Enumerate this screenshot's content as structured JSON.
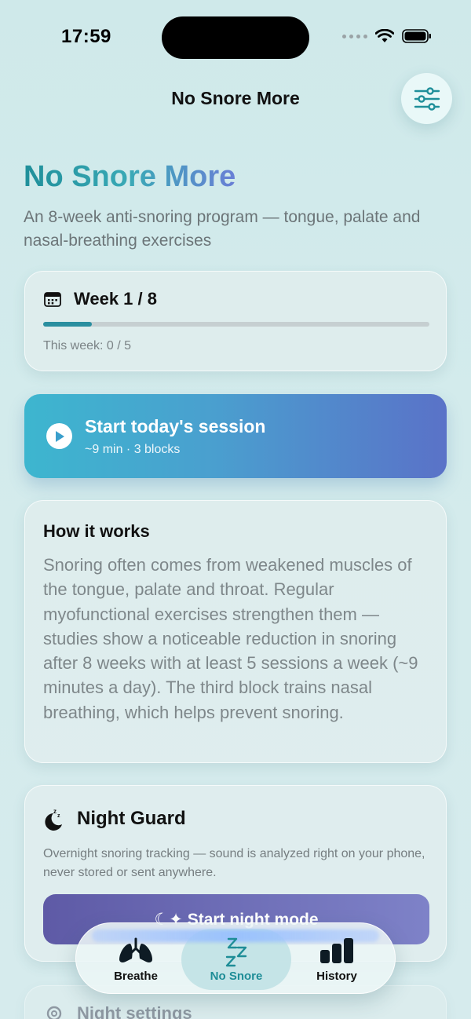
{
  "status": {
    "time": "17:59"
  },
  "nav": {
    "title": "No Snore More",
    "filter_icon": "sliders-icon"
  },
  "hero": {
    "title": "No Snore More",
    "subtitle": "An 8-week anti-snoring program — tongue, palate and nasal-breathing exercises"
  },
  "week": {
    "title": "Week 1 / 8",
    "progress": 0.125,
    "sessions_label": "This week: 0 / 5"
  },
  "session": {
    "title": "Start today's session",
    "subtitle": "~9 min · 3 blocks"
  },
  "how": {
    "title": "How it works",
    "body": "Snoring often comes from weakened muscles of the tongue, palate and throat. Regular myofunctional exercises strengthen them — studies show a noticeable reduction in snoring after 8 weeks with at least 5 sessions a week (~9 minutes a day). The third block trains nasal breathing, which helps prevent snoring."
  },
  "night_guard": {
    "title": "Night Guard",
    "description": "Overnight snoring tracking — sound is analyzed right on your phone, never stored or sent anywhere.",
    "button_label": "Start night mode"
  },
  "settings": {
    "label": "Night settings"
  },
  "tabs": [
    {
      "label": "Breathe",
      "icon": "lungs-icon",
      "active": false
    },
    {
      "label": "No Snore",
      "icon": "zzz-icon",
      "active": true
    },
    {
      "label": "History",
      "icon": "bar-chart-icon",
      "active": false
    }
  ],
  "colors": {
    "accent": "#1e8d97",
    "gradient_start": "#3db6cf",
    "gradient_end": "#5a72c8",
    "night_button": "#6a6cb8"
  }
}
